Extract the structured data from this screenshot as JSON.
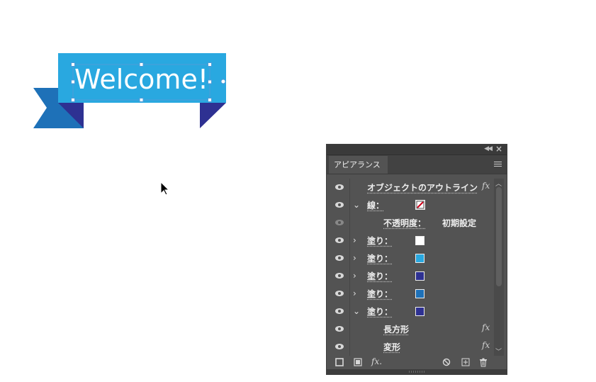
{
  "artwork": {
    "banner_text": "Welcome!",
    "colors": {
      "banner_main": "#29a8e0",
      "ribbon_tail": "#1e71b8",
      "fold": "#2e3192",
      "selection": "#4f9bd7"
    }
  },
  "panel": {
    "tab_label": "アピアランス",
    "header_icons": [
      "collapse-panel-icon",
      "close-icon",
      "panel-menu-icon"
    ],
    "rows": [
      {
        "label": "オブジェクトのアウトライン",
        "fx": "fx"
      },
      {
        "label": "線：",
        "expander": "⌄",
        "swatch": "none-red-slash"
      },
      {
        "label": "不透明度：",
        "value": "初期設定"
      },
      {
        "label": "塗り：",
        "expander": "›",
        "swatch": "#ffffff"
      },
      {
        "label": "塗り：",
        "expander": "›",
        "swatch": "#29a8e0"
      },
      {
        "label": "塗り：",
        "expander": "›",
        "swatch": "#2e3192"
      },
      {
        "label": "塗り：",
        "expander": "›",
        "swatch": "#1e71b8"
      },
      {
        "label": "塗り：",
        "expander": "⌄",
        "swatch": "#2e3192"
      },
      {
        "label": "長方形",
        "fx": "fx"
      },
      {
        "label": "変形",
        "fx": "fx"
      }
    ],
    "bottom_icons": [
      "add-new-stroke-icon",
      "add-new-fill-icon",
      "add-effect-icon",
      "clear-appearance-icon",
      "duplicate-item-icon",
      "delete-icon"
    ],
    "fx_button_label": "fx."
  }
}
